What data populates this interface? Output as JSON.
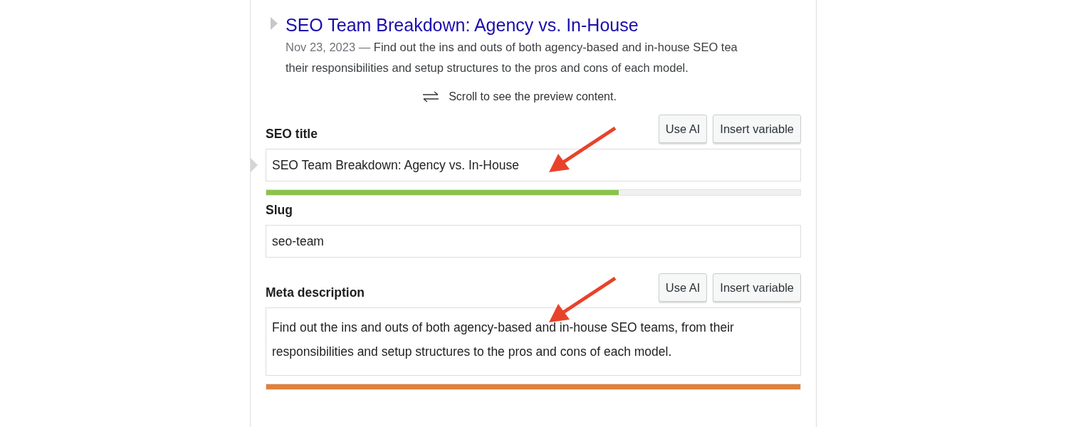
{
  "preview": {
    "title": "SEO Team Breakdown: Agency vs. In-House",
    "date": "Nov 23, 2023 —",
    "lines": [
      "Find out the ins and outs of both agency-based and in-house SEO tea",
      "their responsibilities and setup structures to the pros and cons of each model."
    ]
  },
  "scroll_hint": "Scroll to see the preview content.",
  "fields": [
    {
      "kind": "input",
      "label": "SEO title",
      "buttons": [
        "Use AI",
        "Insert variable"
      ],
      "value": "SEO Team Breakdown: Agency vs. In-House",
      "progress": {
        "level": 0.66,
        "color": "#8bc34a"
      }
    },
    {
      "kind": "input",
      "label": "Slug",
      "value": "seo-team"
    },
    {
      "kind": "textarea",
      "label": "Meta description",
      "buttons": [
        "Use AI",
        "Insert variable"
      ],
      "value": "Find out the ins and outs of both agency-based and in-house SEO teams, from their responsibilities and setup structures to the pros and cons of each model.",
      "progress": {
        "level": 1,
        "color": "#e2803a"
      }
    }
  ]
}
